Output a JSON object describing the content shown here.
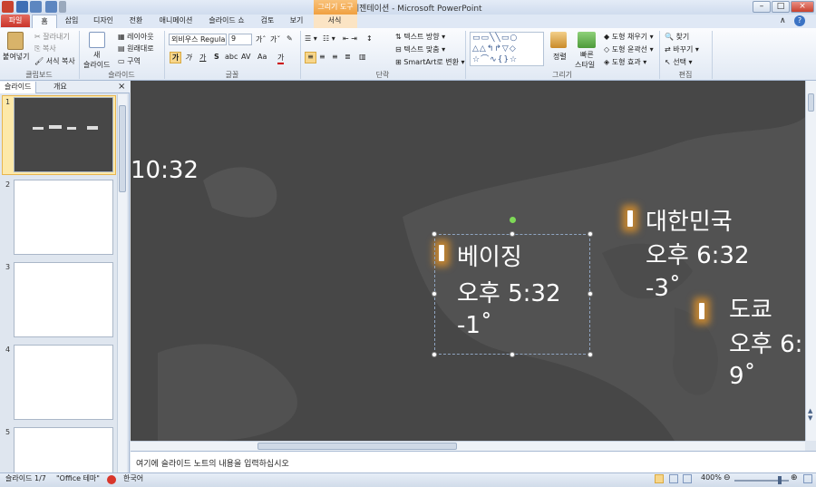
{
  "app": {
    "title": "새 프레젠테이션 - Microsoft PowerPoint",
    "context_tab": "그리기 도구"
  },
  "tabs": [
    "파일",
    "홈",
    "삽입",
    "디자인",
    "전환",
    "애니메이션",
    "슬라이드 쇼",
    "검토",
    "보기",
    "서식"
  ],
  "ribbon": {
    "clipboard": {
      "paste": "붙여넣기",
      "cut": "잘라내기",
      "copy": "복사",
      "format_painter": "서식 복사",
      "label": "클립보드"
    },
    "slides": {
      "new_slide_1": "새",
      "new_slide_2": "슬라이드",
      "layout": "레이아웃",
      "reset": "원래대로",
      "section": "구역",
      "label": "슬라이드"
    },
    "font": {
      "font_name": "외비우스 Regula",
      "font_size": "9",
      "label": "글꼴",
      "bold": "가",
      "italic": "가",
      "underline": "가",
      "strike": "S",
      "shadow": "abc",
      "spacing": "AV",
      "case": "Aa",
      "color": "가"
    },
    "paragraph": {
      "text_direction": "텍스트 방향",
      "align_text": "텍스트 맞춤",
      "smartart": "SmartArt로 변환",
      "label": "단락"
    },
    "drawing": {
      "arrange": "정렬",
      "quick_styles_1": "빠른",
      "quick_styles_2": "스타일",
      "shape_fill": "도형 채우기",
      "shape_outline": "도형 윤곽선",
      "shape_effects": "도형 효과",
      "label": "그리기"
    },
    "editing": {
      "find": "찾기",
      "replace": "바꾸기",
      "select": "선택",
      "label": "편집"
    }
  },
  "panes": {
    "tab_slides": "슬라이드",
    "tab_outline": "개요",
    "close": "×"
  },
  "thumbnails": [
    "1",
    "2",
    "3",
    "4",
    "5"
  ],
  "slide": {
    "partial_time": "10:32",
    "beijing": {
      "city": "베이징",
      "time": "오후 5:32",
      "temp": "-1˚"
    },
    "korea": {
      "city": "대한민국",
      "time": "오후 6:32",
      "temp": "-3˚"
    },
    "tokyo": {
      "city": "도쿄",
      "time": "오후 6:",
      "temp": "9˚"
    }
  },
  "notes": {
    "placeholder": "여기에 슬라이드 노트의 내용을 입력하십시오"
  },
  "status": {
    "slide_count": "슬라이드 1/7",
    "theme": "\"Office 테마\"",
    "language": "한국어",
    "zoom": "400%"
  },
  "colors": {
    "file_tab": "#c9352a",
    "context_tab": "#f0a040",
    "canvas": "#474747",
    "marker_glow": "#e6962a"
  }
}
